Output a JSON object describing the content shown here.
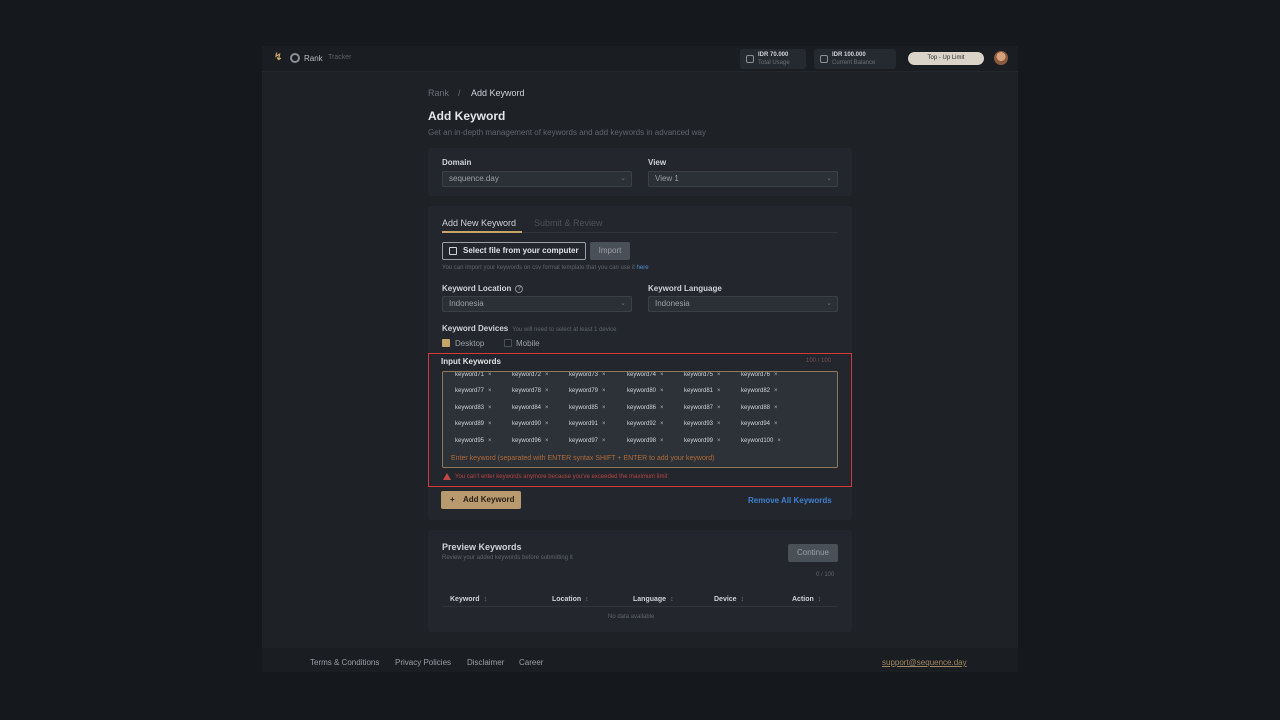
{
  "topbar": {
    "brand_name": "Rank",
    "brand_sub": "Tracker",
    "balance_1": {
      "amount": "IDR 70.000",
      "label": "Total Usage"
    },
    "balance_2": {
      "amount": "IDR 100.000",
      "label": "Current Balance"
    },
    "topup_label": "Top - Up Limit"
  },
  "breadcrumb": {
    "root": "Rank",
    "sep": "/",
    "current": "Add Keyword"
  },
  "page": {
    "title": "Add Keyword",
    "subtitle": "Get an in-depth management of keywords and add keywords in advanced way"
  },
  "filters": {
    "domain_label": "Domain",
    "domain_value": "sequence.day",
    "view_label": "View",
    "view_value": "View 1"
  },
  "tabs": [
    {
      "label": "Add New Keyword",
      "active": true
    },
    {
      "label": "Submit & Review",
      "active": false
    }
  ],
  "import": {
    "file_button": "Select file from your computer",
    "import_button": "Import",
    "hint": "You can import your keywords on csv format template that you can use it",
    "hint_link": "here"
  },
  "location": {
    "label": "Keyword Location",
    "value": "Indonesia"
  },
  "language": {
    "label": "Keyword Language",
    "value": "Indonesia"
  },
  "devices": {
    "label": "Keyword Devices",
    "note": "You will need to select at least 1 device",
    "options": [
      {
        "label": "Desktop",
        "checked": true
      },
      {
        "label": "Mobile",
        "checked": false
      }
    ]
  },
  "keywords": {
    "label": "Input Keywords",
    "count": "100 / 100",
    "chips": [
      "keyword71",
      "keyword72",
      "keyword73",
      "keyword74",
      "keyword75",
      "keyword76",
      "keyword77",
      "keyword78",
      "keyword79",
      "keyword80",
      "keyword81",
      "keyword82",
      "keyword83",
      "keyword84",
      "keyword85",
      "keyword86",
      "keyword87",
      "keyword88",
      "keyword89",
      "keyword90",
      "keyword91",
      "keyword92",
      "keyword93",
      "keyword94",
      "keyword95",
      "keyword96",
      "keyword97",
      "keyword98",
      "keyword99",
      "keyword100"
    ],
    "placeholder": "Enter keyword (separated with ENTER syntax SHIFT + ENTER to add your keyword)",
    "warning": "You can't enter keywords anymore because you've exceeded the maximum limit"
  },
  "actions": {
    "add_label": "Add Keyword",
    "remove_all_label": "Remove All Keywords"
  },
  "preview": {
    "title": "Preview Keywords",
    "subtitle": "Review your added keywords before submitting it",
    "continue_label": "Continue",
    "count": "0 / 100",
    "columns": [
      "Keyword",
      "Location",
      "Language",
      "Device",
      "Action"
    ],
    "empty": "No data available"
  },
  "footer": {
    "links": [
      "Terms & Conditions",
      "Privacy Policies",
      "Disclaimer",
      "Career"
    ],
    "email": "support@sequence.day"
  },
  "colors": {
    "accent": "#c8a468",
    "danger": "#d03a3a",
    "link": "#3f7fd0"
  }
}
